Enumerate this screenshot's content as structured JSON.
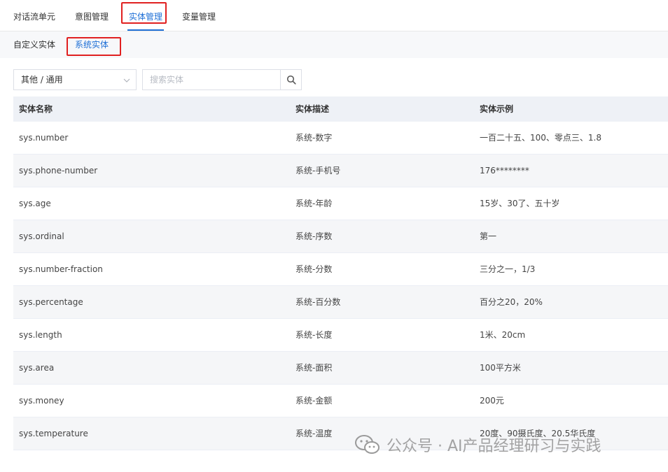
{
  "top_tabs": [
    {
      "label": "对话流单元"
    },
    {
      "label": "意图管理"
    },
    {
      "label": "实体管理",
      "active": true
    },
    {
      "label": "变量管理"
    }
  ],
  "sub_tabs": [
    {
      "label": "自定义实体"
    },
    {
      "label": "系统实体",
      "active": true
    }
  ],
  "filter": {
    "selected": "其他 / 通用",
    "icon": "chevron-down-icon"
  },
  "search": {
    "placeholder": "搜索实体",
    "value": "",
    "icon": "search-icon"
  },
  "table": {
    "headers": [
      "实体名称",
      "实体描述",
      "实体示例"
    ],
    "rows": [
      [
        "sys.number",
        "系统-数字",
        "一百二十五、100、零点三、1.8"
      ],
      [
        "sys.phone-number",
        "系统-手机号",
        "176********"
      ],
      [
        "sys.age",
        "系统-年龄",
        "15岁、30了、五十岁"
      ],
      [
        "sys.ordinal",
        "系统-序数",
        "第一"
      ],
      [
        "sys.number-fraction",
        "系统-分数",
        "三分之一，1/3"
      ],
      [
        "sys.percentage",
        "系统-百分数",
        "百分之20，20%"
      ],
      [
        "sys.length",
        "系统-长度",
        "1米、20cm"
      ],
      [
        "sys.area",
        "系统-面积",
        "100平方米"
      ],
      [
        "sys.money",
        "系统-金额",
        "200元"
      ],
      [
        "sys.temperature",
        "系统-温度",
        "20度、90摄氏度、20.5华氏度"
      ]
    ]
  },
  "watermark": {
    "text": "公众号 · AI产品经理研习与实践",
    "icon": "wechat-icon"
  },
  "colors": {
    "accent": "#1e6fd6",
    "highlight": "#e02020",
    "header_bg": "#eef1f6",
    "alt_row_bg": "#f5f6f8"
  }
}
